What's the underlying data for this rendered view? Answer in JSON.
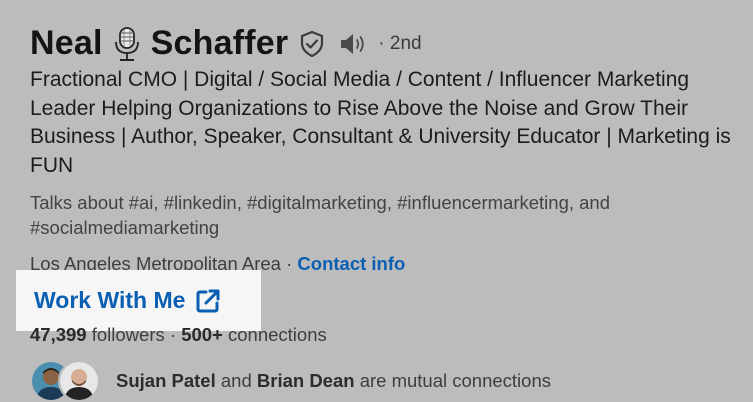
{
  "profile": {
    "first_name": "Neal",
    "last_name": "Schaffer",
    "degree": "· 2nd",
    "headline": "Fractional CMO | Digital / Social Media / Content / Influencer Marketing Leader Helping Organizations to Rise Above the Noise and Grow Their Business | Author, Speaker, Consultant & University Educator | Marketing is FUN",
    "talks_about": "Talks about #ai, #linkedin, #digitalmarketing, #influencermarketing, and #socialmediamarketing",
    "location": "Los Angeles Metropolitan Area",
    "separator": " · ",
    "contact_info_label": "Contact info",
    "work_button_label": "Work With Me",
    "followers_count": "47,399",
    "followers_label": " followers ",
    "connections_separator": " · ",
    "connections_count": "500+",
    "connections_label": " connections",
    "mutual": {
      "name_1": "Sujan Patel",
      "and_text": " and ",
      "name_2": "Brian Dean",
      "suffix": " are mutual connections"
    }
  },
  "icons": {
    "microphone": "microphone-icon",
    "verified": "verified-shield-icon",
    "pronunciation": "speaker-icon",
    "external_link": "external-link-icon"
  },
  "colors": {
    "background": "#bcbcbc",
    "link_blue": "#0a5fb3",
    "highlight_box": "#f6f6f6"
  }
}
